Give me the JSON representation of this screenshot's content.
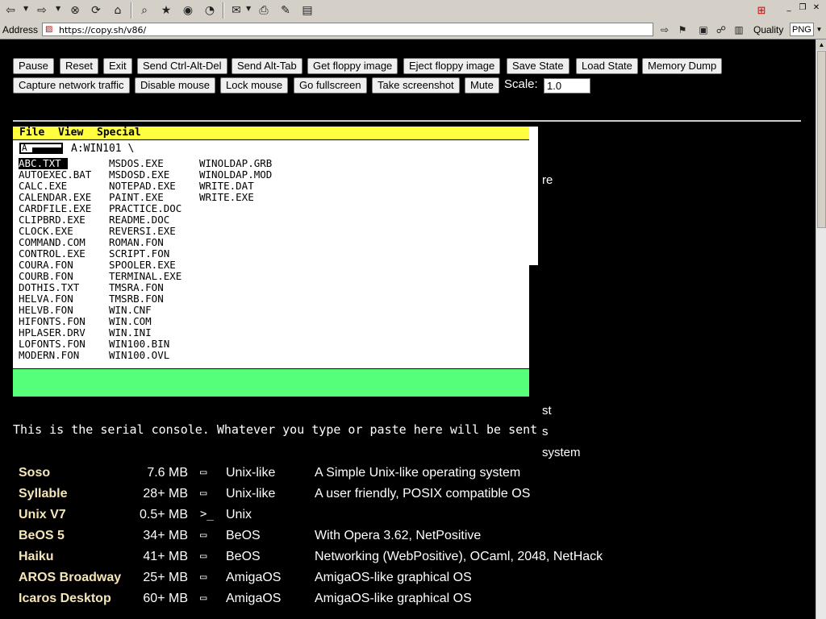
{
  "browser": {
    "address_label": "Address",
    "url": "https://copy.sh/v86/",
    "quality_label": "Quality",
    "format_value": "PNG"
  },
  "controls": {
    "buttons": [
      "Pause",
      "Reset",
      "Exit",
      "Send Ctrl-Alt-Del",
      "Send Alt-Tab",
      "Get floppy image",
      "Eject floppy image",
      "Save State",
      "Load State",
      "Memory Dump",
      "Capture network traffic",
      "Disable mouse",
      "Lock mouse",
      "Go fullscreen",
      "Take screenshot",
      "Mute"
    ],
    "scale_label": "Scale:",
    "scale_value": "1.0"
  },
  "emulator": {
    "menus": [
      "File",
      "View",
      "Special"
    ],
    "drive_letter": "A",
    "path": "A:WIN101 \\",
    "files_col1": [
      "ABC.TXT",
      "AUTOEXEC.BAT",
      "CALC.EXE",
      "CALENDAR.EXE",
      "CARDFILE.EXE",
      "CLIPBRD.EXE",
      "CLOCK.EXE",
      "COMMAND.COM",
      "CONTROL.EXE",
      "COURA.FON",
      "COURB.FON",
      "DOTHIS.TXT",
      "HELVA.FON",
      "HELVB.FON",
      "HIFONTS.FON",
      "HPLASER.DRV",
      "LOFONTS.FON",
      "MODERN.FON"
    ],
    "files_col2": [
      "MSDOS.EXE",
      "MSDOSD.EXE",
      "NOTEPAD.EXE",
      "PAINT.EXE",
      "PRACTICE.DOC",
      "README.DOC",
      "REVERSI.EXE",
      "ROMAN.FON",
      "SCRIPT.FON",
      "SPOOLER.EXE",
      "TERMINAL.EXE",
      "TMSRA.FON",
      "TMSRB.FON",
      "WIN.CNF",
      "WIN.COM",
      "WIN.INI",
      "WIN100.BIN",
      "WIN100.OVL"
    ],
    "files_col3": [
      "WINOLDAP.GRB",
      "WINOLDAP.MOD",
      "WRITE.DAT",
      "WRITE.EXE"
    ],
    "selected_file": "ABC.TXT"
  },
  "page_fragments": {
    "re": "re",
    "st": "st",
    "s": "s",
    "system": "system"
  },
  "serial_console": "This is the serial console. Whatever you type or paste here will be sent",
  "os_list": [
    {
      "name": "Soso",
      "size": "7.6 MB",
      "family": "Unix-like",
      "desc": "A Simple Unix-like operating system",
      "icon": "gui"
    },
    {
      "name": "Syllable",
      "size": "28+ MB",
      "family": "Unix-like",
      "desc": "A user friendly, POSIX compatible OS",
      "icon": "gui"
    },
    {
      "name": "Unix V7",
      "size": "0.5+ MB",
      "family": "Unix",
      "desc": "",
      "icon": "terminal"
    },
    {
      "name": "BeOS 5",
      "size": "34+ MB",
      "family": "BeOS",
      "desc": "With Opera 3.62, NetPositive",
      "icon": "gui"
    },
    {
      "name": "Haiku",
      "size": "41+ MB",
      "family": "BeOS",
      "desc": "Networking (WebPositive), OCaml, 2048, NetHack",
      "icon": "gui"
    },
    {
      "name": "AROS Broadway",
      "size": "25+ MB",
      "family": "AmigaOS",
      "desc": "AmigaOS-like graphical OS",
      "icon": "gui"
    },
    {
      "name": "Icaros Desktop",
      "size": "60+ MB",
      "family": "AmigaOS",
      "desc": "AmigaOS-like graphical OS",
      "icon": "gui"
    }
  ]
}
